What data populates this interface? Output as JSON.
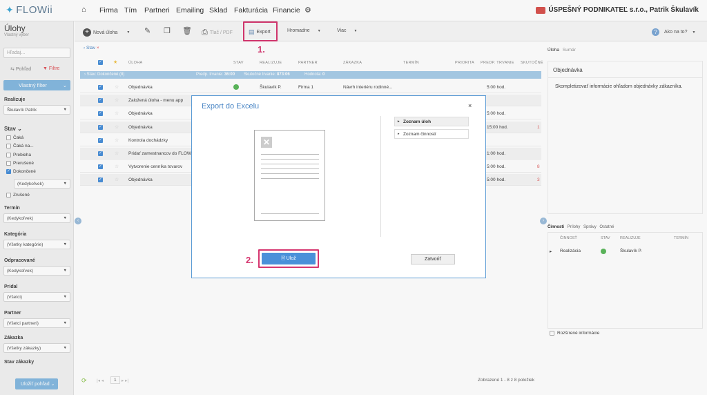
{
  "topnav": {
    "logo": "FLOWii",
    "items": [
      "Firma",
      "Tím",
      "Partneri",
      "Emailing",
      "Sklad",
      "Fakturácia",
      "Financie"
    ],
    "company": "ÚSPEŠNÝ PODNIKATEĽ s.r.o., Patrik Škulavík"
  },
  "sidebar": {
    "title": "Úlohy",
    "subtitle": "Vlastný výber",
    "search_placeholder": "Hľadaj...",
    "tab_view": "Pohľad",
    "tab_filter": "Filtre",
    "custom_filter": "Vlastný filter",
    "realizuje_label": "Realizuje",
    "realizuje_value": "Škulavík Patrik",
    "stav_label": "Stav",
    "stav_options": [
      "Čaká",
      "Čaká na...",
      "Prebieha",
      "Prerušené",
      "Dokončené"
    ],
    "stav_any": "(Kedykoľvek)",
    "zrusene": "Zrušené",
    "termin_label": "Termín",
    "termin_value": "(Kedykoľvek)",
    "kategoria_label": "Kategória",
    "kategoria_value": "(Všetky kategórie)",
    "odpracovane_label": "Odpracované",
    "odpracovane_value": "(Kedykoľvek)",
    "pridal_label": "Pridal",
    "pridal_value": "(Všetci)",
    "partner_label": "Partner",
    "partner_value": "(Všetci partneri)",
    "zakazka_label": "Zákazka",
    "zakazka_value": "(Všetky zákazky)",
    "stav_zakazky_label": "Stav zákazky",
    "save_view": "Uložiť pohľad"
  },
  "toolbar": {
    "new_task": "Nová úloha",
    "print": "Tlač / PDF",
    "export": "Export",
    "bulk": "Hromadne",
    "more": "Viac",
    "help": "Ako na to?"
  },
  "annotations": {
    "one": "1.",
    "two": "2."
  },
  "filter_chip": "Stav",
  "table": {
    "headers": [
      "ÚLOHA",
      "STAV",
      "REALIZUJE",
      "PARTNER",
      "ZÁKAZKA",
      "TERMÍN",
      "PRIORITA",
      "PREDP. TRVANIE",
      "SKUTOČNÉ"
    ],
    "group": "Stav: Dokončené (8)",
    "group_predp_label": "Predp. trvanie:",
    "group_predp": "36:00",
    "group_skut_label": "Skutočné trvanie:",
    "group_skut": "873:06",
    "group_hod_label": "Hodnota:",
    "group_hod": "0",
    "rows": [
      {
        "task": "Objednávka",
        "real": "Škulavík P.",
        "partner": "Firma 1",
        "zakazka": "Návrh interiéru rodinné...",
        "trvanie": "5:00 hod.",
        "skut": "",
        "done": true
      },
      {
        "task": "Založená úloha - menu app",
        "real": "",
        "partner": "",
        "zakazka": "",
        "trvanie": "",
        "skut": "",
        "done": false
      },
      {
        "task": "Objednávka",
        "real": "",
        "partner": "",
        "zakazka": "",
        "trvanie": "5:00 hod.",
        "skut": "",
        "done": false
      },
      {
        "task": "Objednávka",
        "real": "",
        "partner": "",
        "zakazka": "",
        "trvanie": "15:00 hod.",
        "skut": "1",
        "done": false
      },
      {
        "task": "Kontrola dochádzky",
        "real": "",
        "partner": "",
        "zakazka": "",
        "trvanie": "",
        "skut": "",
        "done": false
      },
      {
        "task": "Pridať zamestnancov do FLOW",
        "real": "",
        "partner": "",
        "zakazka": "",
        "trvanie": "1:00 hod.",
        "skut": "",
        "done": false
      },
      {
        "task": "Vytvorenie cenníka tovarov",
        "real": "",
        "partner": "",
        "zakazka": "",
        "trvanie": "5:00 hod.",
        "skut": "8",
        "done": false
      },
      {
        "task": "Objednávka",
        "real": "",
        "partner": "",
        "zakazka": "",
        "trvanie": "5:00 hod.",
        "skut": "3",
        "done": false
      }
    ],
    "footer": "Zobrazené 1 - 8 z 8 položiek",
    "page": "1"
  },
  "right_panel": {
    "tab_uloha": "Úloha",
    "tab_sumar": "Sumár",
    "title": "Objednávka",
    "text": "Skompletizovať informácie ohľadom objednávky zákazníka.",
    "tabs2": [
      "Činnosti",
      "Prílohy",
      "Správy",
      "Ostatné"
    ],
    "grid_headers": [
      "ČINNOSŤ",
      "STAV",
      "REALIZUJE",
      "TERMÍN"
    ],
    "grid_row": {
      "name": "Realizácia",
      "real": "Škulavík P."
    },
    "extended": "Rozšírené informácie"
  },
  "modal": {
    "title": "Export do Excelu",
    "close": "×",
    "options": [
      "Zoznam úloh",
      "Zoznam činností"
    ],
    "save": "Ulož",
    "cancel": "Zatvoriť"
  }
}
